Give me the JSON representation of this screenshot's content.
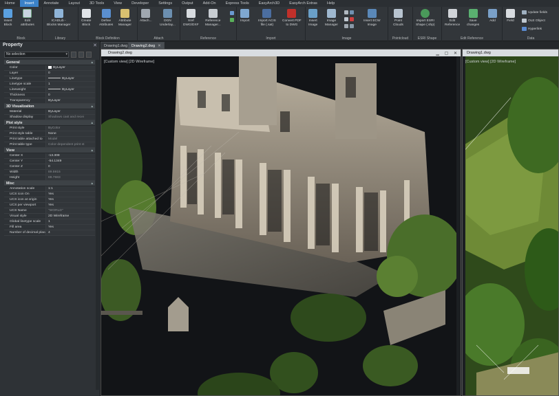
{
  "menu_tabs": [
    "Home",
    "Insert",
    "Annotate",
    "Layout",
    "3D Tools",
    "View",
    "Developer",
    "Settings",
    "Output",
    "Add-On",
    "Express Tools",
    "EasyArch3D",
    "EasyArch Extras",
    "Help"
  ],
  "active_tab": "Insert",
  "ribbon": {
    "groups": [
      {
        "label": "Block",
        "buttons": [
          "Insert\nBlock",
          "Edit\nattributes"
        ]
      },
      {
        "label": "Library",
        "buttons": [
          "ICADLib -\nBlocks Manager"
        ]
      },
      {
        "label": "Block Definition",
        "buttons": [
          "Create\nBlock",
          "Define\nAttributes",
          "Attribute\nManager"
        ]
      },
      {
        "label": "Attach",
        "buttons": [
          "Attach...",
          "DGN\nUnderlay..."
        ]
      },
      {
        "label": "Reference",
        "buttons": [
          "Xref\nDWG/DXF",
          "Reference\nManager..."
        ]
      },
      {
        "label": "Import",
        "buttons": [
          "Import",
          "Import ACIS\nfile (.sat)",
          "Convert PDF\nto DWG"
        ]
      },
      {
        "label": "Image",
        "buttons": [
          "Insert\nImage",
          "Image\nManager",
          "Insert ECW\nImage"
        ]
      },
      {
        "label": "Pointcloud",
        "buttons": [
          "Point\nClouds"
        ]
      },
      {
        "label": "ESRI Shape",
        "buttons": [
          "Import ESRI\nShape (.shp)"
        ]
      },
      {
        "label": "Edit Reference",
        "buttons": [
          "Edit\nReference",
          "Save\nchanges",
          "Add"
        ]
      },
      {
        "label": "Data",
        "buttons": [
          "Field"
        ]
      }
    ],
    "data_small": [
      "Update fields",
      "OLE Object",
      "Hyperlink"
    ]
  },
  "panel": {
    "title": "Property",
    "selection": "No selection",
    "categories": [
      {
        "name": "General",
        "rows": [
          [
            "Color",
            "ByLayer"
          ],
          [
            "Layer",
            "0"
          ],
          [
            "Linetype",
            "ByLayer"
          ],
          [
            "Linetype scale",
            "1"
          ],
          [
            "Lineweight",
            "ByLayer"
          ],
          [
            "Thickness",
            "0"
          ],
          [
            "Transparency",
            "ByLayer"
          ]
        ]
      },
      {
        "name": "3D Visualization",
        "rows": [
          [
            "Material",
            "ByLayer"
          ],
          [
            "Shadow display",
            "Shadows cast and recei"
          ]
        ]
      },
      {
        "name": "Plot style",
        "rows": [
          [
            "Print style",
            "ByColor"
          ],
          [
            "Print style table",
            "None"
          ],
          [
            "Print table attached to",
            "Model"
          ],
          [
            "Print table type",
            "Color-dependent print st"
          ]
        ]
      },
      {
        "name": "View",
        "rows": [
          [
            "Center X",
            "-13.308"
          ],
          [
            "Center Y",
            "-54.1349"
          ],
          [
            "Center Z",
            "0"
          ],
          [
            "Width",
            "89.5915"
          ],
          [
            "Height",
            "88.7683"
          ]
        ]
      },
      {
        "name": "Misc",
        "rows": [
          [
            "Annotation scale",
            "1:1"
          ],
          [
            "UCS icon On",
            "Yes"
          ],
          [
            "UCS icon at origin",
            "Yes"
          ],
          [
            "UCS per viewport",
            "Yes"
          ],
          [
            "UCS Name",
            "\"WORLD\""
          ],
          [
            "Visual style",
            "2D Wireframe"
          ],
          [
            "Global linetype scale",
            "1"
          ],
          [
            "Fill area",
            "Yes"
          ],
          [
            "Number of decimal places",
            "4"
          ]
        ]
      }
    ]
  },
  "doc_tabs": [
    "Drawing1.dwg",
    "Drawing2.dwg"
  ],
  "active_doc": "Drawing2.dwg",
  "viewports": {
    "left": {
      "title": "Drawing2.dwg",
      "label": "[Custom view] [2D Wireframe]"
    },
    "right": {
      "title": "Drawing1.dwg",
      "label": "[Custom view] [2D Wireframe]"
    }
  },
  "colors": {
    "accent": "#3b82c8",
    "panel": "#2e3236",
    "ribbon": "#32363a"
  }
}
